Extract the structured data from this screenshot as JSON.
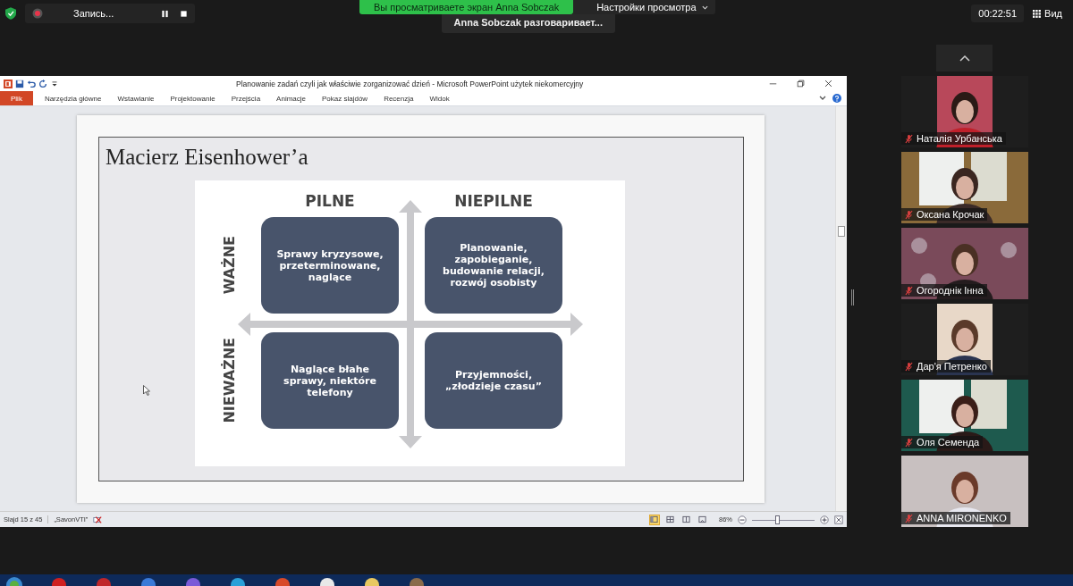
{
  "meeting_bar": {
    "recording_label": "Запись...",
    "share_banner": "Вы просматриваете экран Anna Sobczak",
    "view_options": "Настройки просмотра",
    "active_speaker": "Anna Sobczak разговаривает...",
    "timer": "00:22:51",
    "view_button": "Вид"
  },
  "presentation_window": {
    "title": "Planowanie zadań czyli jak właściwie zorganizować dzień  -  Microsoft PowerPoint użytek niekomercyjny",
    "ribbon_tabs": [
      {
        "label": "Plik",
        "kind": "file"
      },
      {
        "label": "Narzędzia główne",
        "kind": "tab"
      },
      {
        "label": "Wstawianie",
        "kind": "tab"
      },
      {
        "label": "Projektowanie",
        "kind": "tab"
      },
      {
        "label": "Przejścia",
        "kind": "tab"
      },
      {
        "label": "Animacje",
        "kind": "tab"
      },
      {
        "label": "Pokaz slajdów",
        "kind": "tab"
      },
      {
        "label": "Recenzja",
        "kind": "tab"
      },
      {
        "label": "Widok",
        "kind": "tab"
      }
    ],
    "slide": {
      "title": "Macierz Eisenhower’a",
      "column_headers": [
        "PILNE",
        "NIEPILNE"
      ],
      "row_headers": [
        "WAŻNE",
        "NIEWAŻNE"
      ],
      "cells": [
        [
          "Sprawy kryzysowe, przeterminowane, naglące",
          "Planowanie, zapobieganie, budowanie relacji, rozwój osobisty"
        ],
        [
          "Naglące błahe sprawy, niektóre telefony",
          "Przyjemności, „złodzieje czasu”"
        ]
      ]
    },
    "status_bar": {
      "slide_counter": "Slajd 15 z 45",
      "theme": "„SavonVTI”",
      "view_buttons": [
        {
          "selected": true
        },
        {
          "selected": false
        },
        {
          "selected": false
        },
        {
          "selected": false
        }
      ],
      "zoom_percent": "86%",
      "zoom_slider": {
        "level": 0.42
      }
    }
  },
  "participants": [
    {
      "name": "Наталія Урбанська",
      "muted": true
    },
    {
      "name": "Оксана Крочак",
      "muted": true
    },
    {
      "name": "Огороднік Інна",
      "muted": true
    },
    {
      "name": "Дар'я Петренко",
      "muted": true
    },
    {
      "name": "Оля Семенда",
      "muted": true
    },
    {
      "name": "ANNA MIRONENKO",
      "muted": true
    }
  ]
}
